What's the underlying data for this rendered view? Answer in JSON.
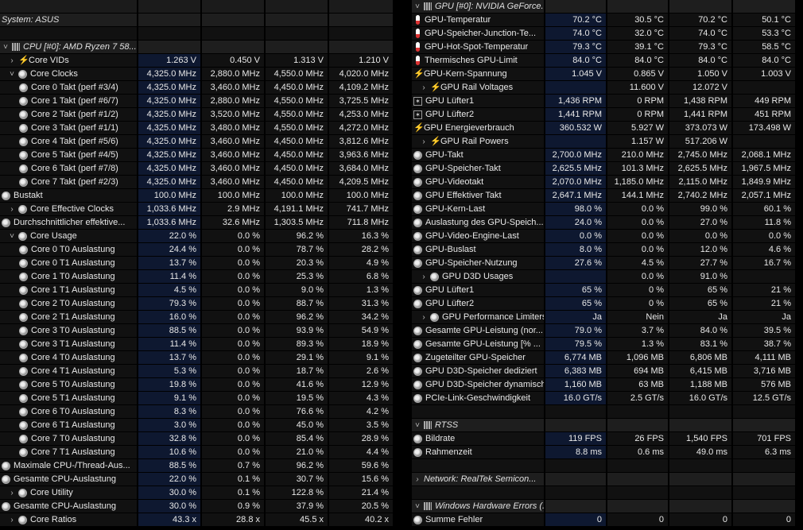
{
  "headers": [
    "Sensor",
    "Aktuell",
    "Minimal",
    "Maximal",
    "Durchschnitt"
  ],
  "header_visible": [
    "ensor",
    "Aktuell",
    "Minimal",
    "Maximal",
    "Durchschnitt"
  ],
  "left": [
    {
      "kind": "sec",
      "name": "System: ASUS",
      "icon": "none"
    },
    {
      "kind": "gap"
    },
    {
      "kind": "sec",
      "name": "CPU [#0]: AMD Ryzen 7 58...",
      "icon": "chip",
      "chev": "down"
    },
    {
      "kind": "row",
      "name": "Core VIDs",
      "icon": "bolt",
      "chev": "right",
      "ind": 1,
      "v": [
        "1.263 V",
        "0.450 V",
        "1.313 V",
        "1.210 V"
      ]
    },
    {
      "kind": "row",
      "name": "Core Clocks",
      "icon": "clock",
      "chev": "down",
      "ind": 1,
      "v": [
        "4,325.0 MHz",
        "2,880.0 MHz",
        "4,550.0 MHz",
        "4,020.0 MHz"
      ]
    },
    {
      "kind": "row",
      "name": "Core 0 Takt (perf #3/4)",
      "icon": "clock",
      "ind": 2,
      "v": [
        "4,325.0 MHz",
        "3,460.0 MHz",
        "4,450.0 MHz",
        "4,109.2 MHz"
      ]
    },
    {
      "kind": "row",
      "name": "Core 1 Takt (perf #6/7)",
      "icon": "clock",
      "ind": 2,
      "v": [
        "4,325.0 MHz",
        "2,880.0 MHz",
        "4,550.0 MHz",
        "3,725.5 MHz"
      ]
    },
    {
      "kind": "row",
      "name": "Core 2 Takt (perf #1/2)",
      "icon": "clock",
      "ind": 2,
      "v": [
        "4,325.0 MHz",
        "3,520.0 MHz",
        "4,550.0 MHz",
        "4,253.0 MHz"
      ]
    },
    {
      "kind": "row",
      "name": "Core 3 Takt (perf #1/1)",
      "icon": "clock",
      "ind": 2,
      "v": [
        "4,325.0 MHz",
        "3,480.0 MHz",
        "4,550.0 MHz",
        "4,272.0 MHz"
      ]
    },
    {
      "kind": "row",
      "name": "Core 4 Takt (perf #5/6)",
      "icon": "clock",
      "ind": 2,
      "v": [
        "4,325.0 MHz",
        "3,460.0 MHz",
        "4,450.0 MHz",
        "3,812.6 MHz"
      ]
    },
    {
      "kind": "row",
      "name": "Core 5 Takt (perf #4/5)",
      "icon": "clock",
      "ind": 2,
      "v": [
        "4,325.0 MHz",
        "3,460.0 MHz",
        "4,450.0 MHz",
        "3,963.6 MHz"
      ]
    },
    {
      "kind": "row",
      "name": "Core 6 Takt (perf #7/8)",
      "icon": "clock",
      "ind": 2,
      "v": [
        "4,325.0 MHz",
        "3,460.0 MHz",
        "4,450.0 MHz",
        "3,684.0 MHz"
      ]
    },
    {
      "kind": "row",
      "name": "Core 7 Takt (perf #2/3)",
      "icon": "clock",
      "ind": 2,
      "v": [
        "4,325.0 MHz",
        "3,460.0 MHz",
        "4,450.0 MHz",
        "4,209.5 MHz"
      ]
    },
    {
      "kind": "row",
      "name": "Bustakt",
      "icon": "clock",
      "ind": 0,
      "v": [
        "100.0 MHz",
        "100.0 MHz",
        "100.0 MHz",
        "100.0 MHz"
      ]
    },
    {
      "kind": "row",
      "name": "Core Effective Clocks",
      "icon": "clock",
      "chev": "right",
      "ind": 1,
      "v": [
        "1,033.6 MHz",
        "2.9 MHz",
        "4,191.1 MHz",
        "741.7 MHz"
      ]
    },
    {
      "kind": "row",
      "name": "Durchschnittlicher effektive...",
      "icon": "clock",
      "ind": 0,
      "v": [
        "1,033.6 MHz",
        "32.6 MHz",
        "1,303.5 MHz",
        "711.8 MHz"
      ]
    },
    {
      "kind": "row",
      "name": "Core Usage",
      "icon": "clock",
      "chev": "down",
      "ind": 1,
      "v": [
        "22.0 %",
        "0.0 %",
        "96.2 %",
        "16.3 %"
      ]
    },
    {
      "kind": "row",
      "name": "Core 0 T0 Auslastung",
      "icon": "clock",
      "ind": 2,
      "v": [
        "24.4 %",
        "0.0 %",
        "78.7 %",
        "28.2 %"
      ]
    },
    {
      "kind": "row",
      "name": "Core 0 T1 Auslastung",
      "icon": "clock",
      "ind": 2,
      "v": [
        "13.7 %",
        "0.0 %",
        "20.3 %",
        "4.9 %"
      ]
    },
    {
      "kind": "row",
      "name": "Core 1 T0 Auslastung",
      "icon": "clock",
      "ind": 2,
      "v": [
        "11.4 %",
        "0.0 %",
        "25.3 %",
        "6.8 %"
      ]
    },
    {
      "kind": "row",
      "name": "Core 1 T1 Auslastung",
      "icon": "clock",
      "ind": 2,
      "v": [
        "4.5 %",
        "0.0 %",
        "9.0 %",
        "1.3 %"
      ]
    },
    {
      "kind": "row",
      "name": "Core 2 T0 Auslastung",
      "icon": "clock",
      "ind": 2,
      "v": [
        "79.3 %",
        "0.0 %",
        "88.7 %",
        "31.3 %"
      ]
    },
    {
      "kind": "row",
      "name": "Core 2 T1 Auslastung",
      "icon": "clock",
      "ind": 2,
      "v": [
        "16.0 %",
        "0.0 %",
        "96.2 %",
        "34.2 %"
      ]
    },
    {
      "kind": "row",
      "name": "Core 3 T0 Auslastung",
      "icon": "clock",
      "ind": 2,
      "v": [
        "88.5 %",
        "0.0 %",
        "93.9 %",
        "54.9 %"
      ]
    },
    {
      "kind": "row",
      "name": "Core 3 T1 Auslastung",
      "icon": "clock",
      "ind": 2,
      "v": [
        "11.4 %",
        "0.0 %",
        "89.3 %",
        "18.9 %"
      ]
    },
    {
      "kind": "row",
      "name": "Core 4 T0 Auslastung",
      "icon": "clock",
      "ind": 2,
      "v": [
        "13.7 %",
        "0.0 %",
        "29.1 %",
        "9.1 %"
      ]
    },
    {
      "kind": "row",
      "name": "Core 4 T1 Auslastung",
      "icon": "clock",
      "ind": 2,
      "v": [
        "5.3 %",
        "0.0 %",
        "18.7 %",
        "2.6 %"
      ]
    },
    {
      "kind": "row",
      "name": "Core 5 T0 Auslastung",
      "icon": "clock",
      "ind": 2,
      "v": [
        "19.8 %",
        "0.0 %",
        "41.6 %",
        "12.9 %"
      ]
    },
    {
      "kind": "row",
      "name": "Core 5 T1 Auslastung",
      "icon": "clock",
      "ind": 2,
      "v": [
        "9.1 %",
        "0.0 %",
        "19.5 %",
        "4.3 %"
      ]
    },
    {
      "kind": "row",
      "name": "Core 6 T0 Auslastung",
      "icon": "clock",
      "ind": 2,
      "v": [
        "8.3 %",
        "0.0 %",
        "76.6 %",
        "4.2 %"
      ]
    },
    {
      "kind": "row",
      "name": "Core 6 T1 Auslastung",
      "icon": "clock",
      "ind": 2,
      "v": [
        "3.0 %",
        "0.0 %",
        "45.0 %",
        "3.5 %"
      ]
    },
    {
      "kind": "row",
      "name": "Core 7 T0 Auslastung",
      "icon": "clock",
      "ind": 2,
      "v": [
        "32.8 %",
        "0.0 %",
        "85.4 %",
        "28.9 %"
      ]
    },
    {
      "kind": "row",
      "name": "Core 7 T1 Auslastung",
      "icon": "clock",
      "ind": 2,
      "v": [
        "10.6 %",
        "0.0 %",
        "21.0 %",
        "4.4 %"
      ]
    },
    {
      "kind": "row",
      "name": "Maximale CPU-/Thread-Aus...",
      "icon": "clock",
      "ind": 0,
      "v": [
        "88.5 %",
        "0.7 %",
        "96.2 %",
        "59.6 %"
      ]
    },
    {
      "kind": "row",
      "name": "Gesamte CPU-Auslastung",
      "icon": "clock",
      "ind": 0,
      "v": [
        "22.0 %",
        "0.1 %",
        "30.7 %",
        "15.6 %"
      ]
    },
    {
      "kind": "row",
      "name": "Core Utility",
      "icon": "clock",
      "chev": "right",
      "ind": 1,
      "v": [
        "30.0 %",
        "0.1 %",
        "122.8 %",
        "21.4 %"
      ]
    },
    {
      "kind": "row",
      "name": "Gesamte CPU-Auslastung",
      "icon": "clock",
      "ind": 0,
      "v": [
        "30.0 %",
        "0.9 %",
        "37.9 %",
        "20.5 %"
      ]
    },
    {
      "kind": "row",
      "name": "Core Ratios",
      "icon": "clock",
      "chev": "right",
      "ind": 1,
      "v": [
        "43.3 x",
        "28.8 x",
        "45.5 x",
        "40.2 x"
      ]
    }
  ],
  "right": [
    {
      "kind": "sec",
      "name": "GPU [#0]: NVIDIA GeForce...",
      "icon": "chip",
      "chev": "down"
    },
    {
      "kind": "row",
      "name": "GPU-Temperatur",
      "icon": "therm",
      "ind": 0,
      "v": [
        "70.2 °C",
        "30.5 °C",
        "70.2 °C",
        "50.1 °C"
      ]
    },
    {
      "kind": "row",
      "name": "GPU-Speicher-Junction-Te...",
      "icon": "therm",
      "ind": 0,
      "v": [
        "74.0 °C",
        "32.0 °C",
        "74.0 °C",
        "53.3 °C"
      ]
    },
    {
      "kind": "row",
      "name": "GPU-Hot-Spot-Temperatur",
      "icon": "therm",
      "ind": 0,
      "v": [
        "79.3 °C",
        "39.1 °C",
        "79.3 °C",
        "58.5 °C"
      ]
    },
    {
      "kind": "row",
      "name": "Thermisches GPU-Limit",
      "icon": "therm",
      "ind": 0,
      "v": [
        "84.0 °C",
        "84.0 °C",
        "84.0 °C",
        "84.0 °C"
      ]
    },
    {
      "kind": "row",
      "name": "GPU-Kern-Spannung",
      "icon": "bolt",
      "ind": 0,
      "v": [
        "1.045 V",
        "0.865 V",
        "1.050 V",
        "1.003 V"
      ]
    },
    {
      "kind": "row",
      "name": "GPU Rail Voltages",
      "icon": "bolt",
      "chev": "right",
      "ind": 1,
      "v": [
        "",
        "11.600 V",
        "12.072 V",
        ""
      ]
    },
    {
      "kind": "row",
      "name": "GPU Lüfter1",
      "icon": "fan",
      "ind": 0,
      "v": [
        "1,436 RPM",
        "0 RPM",
        "1,438 RPM",
        "449 RPM"
      ]
    },
    {
      "kind": "row",
      "name": "GPU Lüfter2",
      "icon": "fan",
      "ind": 0,
      "v": [
        "1,441 RPM",
        "0 RPM",
        "1,441 RPM",
        "451 RPM"
      ]
    },
    {
      "kind": "row",
      "name": "GPU Energieverbrauch",
      "icon": "bolt",
      "ind": 0,
      "v": [
        "360.532 W",
        "5.927 W",
        "373.073 W",
        "173.498 W"
      ]
    },
    {
      "kind": "row",
      "name": "GPU Rail Powers",
      "icon": "bolt",
      "chev": "right",
      "ind": 1,
      "v": [
        "",
        "1.157 W",
        "517.206 W",
        ""
      ]
    },
    {
      "kind": "row",
      "name": "GPU-Takt",
      "icon": "clock",
      "ind": 0,
      "v": [
        "2,700.0 MHz",
        "210.0 MHz",
        "2,745.0 MHz",
        "2,068.1 MHz"
      ]
    },
    {
      "kind": "row",
      "name": "GPU-Speicher-Takt",
      "icon": "clock",
      "ind": 0,
      "v": [
        "2,625.5 MHz",
        "101.3 MHz",
        "2,625.5 MHz",
        "1,967.5 MHz"
      ]
    },
    {
      "kind": "row",
      "name": "GPU-Videotakt",
      "icon": "clock",
      "ind": 0,
      "v": [
        "2,070.0 MHz",
        "1,185.0 MHz",
        "2,115.0 MHz",
        "1,849.9 MHz"
      ]
    },
    {
      "kind": "row",
      "name": "GPU Effektiver Takt",
      "icon": "clock",
      "ind": 0,
      "v": [
        "2,647.1 MHz",
        "144.1 MHz",
        "2,740.2 MHz",
        "2,057.1 MHz"
      ]
    },
    {
      "kind": "row",
      "name": "GPU-Kern-Last",
      "icon": "clock",
      "ind": 0,
      "v": [
        "98.0 %",
        "0.0 %",
        "99.0 %",
        "60.1 %"
      ]
    },
    {
      "kind": "row",
      "name": "Auslastung des GPU-Speich...",
      "icon": "clock",
      "ind": 0,
      "v": [
        "24.0 %",
        "0.0 %",
        "27.0 %",
        "11.8 %"
      ]
    },
    {
      "kind": "row",
      "name": "GPU-Video-Engine-Last",
      "icon": "clock",
      "ind": 0,
      "v": [
        "0.0 %",
        "0.0 %",
        "0.0 %",
        "0.0 %"
      ]
    },
    {
      "kind": "row",
      "name": "GPU-Buslast",
      "icon": "clock",
      "ind": 0,
      "v": [
        "8.0 %",
        "0.0 %",
        "12.0 %",
        "4.6 %"
      ]
    },
    {
      "kind": "row",
      "name": "GPU-Speicher-Nutzung",
      "icon": "clock",
      "ind": 0,
      "v": [
        "27.6 %",
        "4.5 %",
        "27.7 %",
        "16.7 %"
      ]
    },
    {
      "kind": "row",
      "name": "GPU D3D Usages",
      "icon": "clock",
      "chev": "right",
      "ind": 1,
      "v": [
        "",
        "0.0 %",
        "91.0 %",
        ""
      ]
    },
    {
      "kind": "row",
      "name": "GPU Lüfter1",
      "icon": "clock",
      "ind": 0,
      "v": [
        "65 %",
        "0 %",
        "65 %",
        "21 %"
      ]
    },
    {
      "kind": "row",
      "name": "GPU Lüfter2",
      "icon": "clock",
      "ind": 0,
      "v": [
        "65 %",
        "0 %",
        "65 %",
        "21 %"
      ]
    },
    {
      "kind": "row",
      "name": "GPU Performance Limiters",
      "icon": "clock",
      "chev": "right",
      "ind": 1,
      "v": [
        "Ja",
        "Nein",
        "Ja",
        "Ja"
      ]
    },
    {
      "kind": "row",
      "name": "Gesamte GPU-Leistung (nor...",
      "icon": "clock",
      "ind": 0,
      "v": [
        "79.0 %",
        "3.7 %",
        "84.0 %",
        "39.5 %"
      ]
    },
    {
      "kind": "row",
      "name": "Gesamte GPU-Leistung [% ...",
      "icon": "clock",
      "ind": 0,
      "v": [
        "79.5 %",
        "1.3 %",
        "83.1 %",
        "38.7 %"
      ]
    },
    {
      "kind": "row",
      "name": "Zugeteilter GPU-Speicher",
      "icon": "clock",
      "ind": 0,
      "v": [
        "6,774 MB",
        "1,096 MB",
        "6,806 MB",
        "4,111 MB"
      ]
    },
    {
      "kind": "row",
      "name": "GPU D3D-Speicher dediziert",
      "icon": "clock",
      "ind": 0,
      "v": [
        "6,383 MB",
        "694 MB",
        "6,415 MB",
        "3,716 MB"
      ]
    },
    {
      "kind": "row",
      "name": "GPU D3D-Speicher dynamisch",
      "icon": "clock",
      "ind": 0,
      "v": [
        "1,160 MB",
        "63 MB",
        "1,188 MB",
        "576 MB"
      ]
    },
    {
      "kind": "row",
      "name": "PCIe-Link-Geschwindigkeit",
      "icon": "clock",
      "ind": 0,
      "v": [
        "16.0 GT/s",
        "2.5 GT/s",
        "16.0 GT/s",
        "12.5 GT/s"
      ]
    },
    {
      "kind": "gap"
    },
    {
      "kind": "sec",
      "name": "RTSS",
      "icon": "chip",
      "chev": "down"
    },
    {
      "kind": "row",
      "name": "Bildrate",
      "icon": "clock",
      "ind": 0,
      "v": [
        "119 FPS",
        "26 FPS",
        "1,540 FPS",
        "701 FPS"
      ]
    },
    {
      "kind": "row",
      "name": "Rahmenzeit",
      "icon": "clock",
      "ind": 0,
      "v": [
        "8.8 ms",
        "0.6 ms",
        "49.0 ms",
        "6.3 ms"
      ]
    },
    {
      "kind": "gap"
    },
    {
      "kind": "sec",
      "name": "Network: RealTek Semicon...",
      "icon": "none",
      "chev": "right"
    },
    {
      "kind": "gap"
    },
    {
      "kind": "sec",
      "name": "Windows Hardware Errors (...",
      "icon": "chip",
      "chev": "down"
    },
    {
      "kind": "row",
      "name": "Summe Fehler",
      "icon": "clock",
      "ind": 0,
      "v": [
        "0",
        "0",
        "0",
        "0"
      ]
    }
  ],
  "colors": {
    "bg": "#000000",
    "cell": "#111111",
    "active": "#0e1830",
    "header": "#1b1b1b",
    "section": "#1e1e1e"
  }
}
